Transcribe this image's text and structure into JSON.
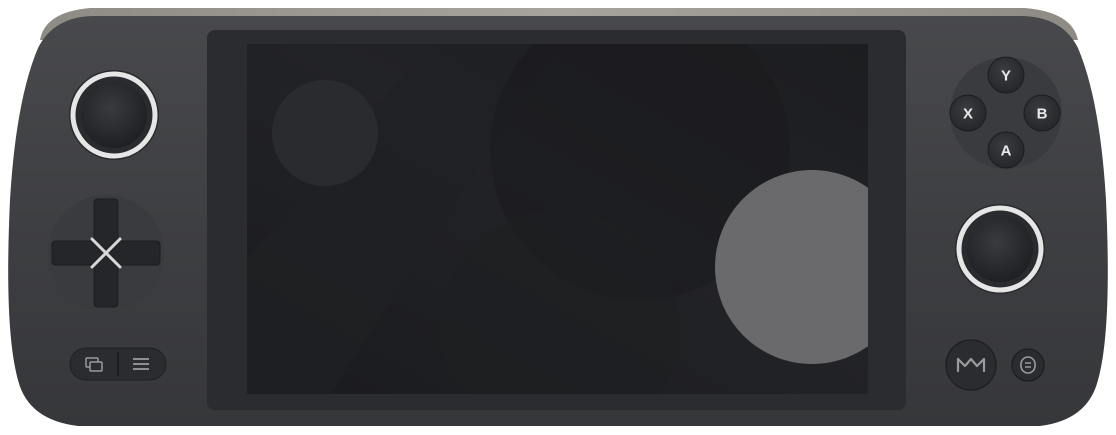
{
  "device": {
    "face_buttons": {
      "y": "Y",
      "x": "X",
      "b": "B",
      "a": "A"
    },
    "icons": {
      "left_stick": "analog-stick-icon",
      "right_stick": "analog-stick-icon",
      "dpad": "dpad-icon",
      "view": "view-windows-icon",
      "menu": "menu-hamburger-icon",
      "brand": "brand-logo-icon",
      "extra": "extra-button-icon"
    },
    "colors": {
      "body": "#3f4043",
      "bezel": "#2d2e31",
      "screen": "#1b1c1f",
      "accent_ring": "#e6e6e6"
    }
  }
}
